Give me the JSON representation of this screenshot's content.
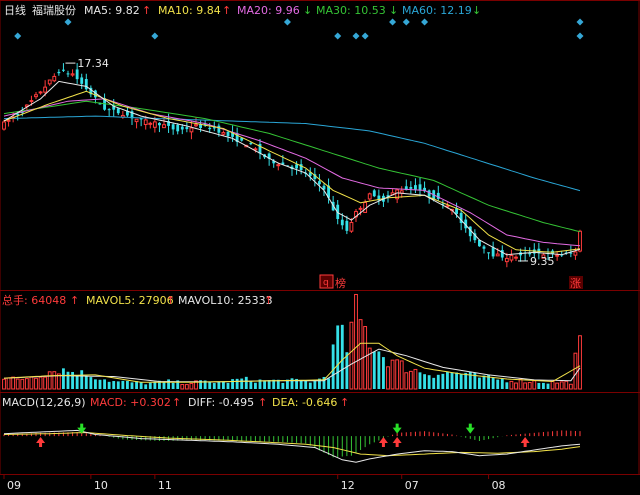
{
  "colors": {
    "up": "#ff3b3b",
    "down": "#35e0e8",
    "grid": "#7a0000",
    "ma5": "#e8e8e8",
    "ma10": "#f2e24a",
    "ma20": "#e36be3",
    "ma30": "#35c435",
    "ma60": "#2aa6d6",
    "diff": "#e8e8e8",
    "dea": "#f2e24a",
    "macd_pos": "#ff3b3b",
    "macd_neg": "#35c435",
    "marker": "#35a7d6"
  },
  "header": {
    "period": "日线",
    "stock_name": "福瑞股份",
    "ma5": {
      "label": "MA5: 9.82",
      "dir": "up"
    },
    "ma10": {
      "label": "MA10: 9.84",
      "dir": "up"
    },
    "ma20": {
      "label": "MA20: 9.96",
      "dir": "down"
    },
    "ma30": {
      "label": "MA30: 10.53",
      "dir": "down"
    },
    "ma60": {
      "label": "MA60: 12.19",
      "dir": "down"
    }
  },
  "volume_header": {
    "total": {
      "label": "总手: 64048",
      "dir": "up"
    },
    "mavol5": {
      "label": "MAVOL5: 27906",
      "dir": "up"
    },
    "mavol10": {
      "label": "MAVOL10: 25333",
      "dir": "up"
    }
  },
  "macd_header": {
    "name": "MACD(12,26,9)",
    "macd": {
      "label": "MACD: +0.302",
      "dir": "up"
    },
    "diff": {
      "label": "DIFF: -0.495",
      "dir": "up"
    },
    "dea": {
      "label": "DEA: -0.646",
      "dir": "up"
    }
  },
  "annotations": {
    "high_label": "17.34",
    "low_label": "9.35",
    "badge_bang": "榜",
    "badge_zhang": "涨"
  },
  "x_axis": {
    "labels": [
      {
        "text": "09",
        "index": 0
      },
      {
        "text": "10",
        "index": 19
      },
      {
        "text": "11",
        "index": 33
      },
      {
        "text": "12",
        "index": 73
      },
      {
        "text": "07",
        "index": 87
      },
      {
        "text": "08",
        "index": 106
      }
    ]
  },
  "chart_data": {
    "type": "candlestick",
    "n_bars": 127,
    "price_range": [
      8.5,
      19.0
    ],
    "volume_range": [
      0,
      95000
    ],
    "macd_range": [
      -2.2,
      1.6
    ],
    "anchors": {
      "close": [
        [
          0,
          14.9
        ],
        [
          4,
          15.4
        ],
        [
          8,
          16.2
        ],
        [
          12,
          17.0
        ],
        [
          15,
          16.9
        ],
        [
          18,
          16.3
        ],
        [
          22,
          15.5
        ],
        [
          26,
          15.3
        ],
        [
          30,
          15.0
        ],
        [
          34,
          14.9
        ],
        [
          38,
          14.6
        ],
        [
          42,
          14.8
        ],
        [
          46,
          14.7
        ],
        [
          50,
          14.3
        ],
        [
          54,
          14.0
        ],
        [
          58,
          13.4
        ],
        [
          62,
          13.2
        ],
        [
          66,
          12.9
        ],
        [
          70,
          12.3
        ],
        [
          73,
          11.0
        ],
        [
          75,
          10.6
        ],
        [
          77,
          11.3
        ],
        [
          80,
          12.0
        ],
        [
          83,
          11.8
        ],
        [
          86,
          12.2
        ],
        [
          90,
          12.3
        ],
        [
          94,
          11.9
        ],
        [
          98,
          11.5
        ],
        [
          101,
          10.6
        ],
        [
          104,
          10.0
        ],
        [
          107,
          9.6
        ],
        [
          110,
          9.5
        ],
        [
          113,
          9.55
        ],
        [
          116,
          9.7
        ],
        [
          119,
          9.6
        ],
        [
          122,
          9.6
        ],
        [
          125,
          9.7
        ],
        [
          126,
          10.6
        ]
      ],
      "volume": [
        [
          0,
          13000
        ],
        [
          3,
          11000
        ],
        [
          8,
          18000
        ],
        [
          12,
          24000
        ],
        [
          16,
          20000
        ],
        [
          20,
          15000
        ],
        [
          24,
          9000
        ],
        [
          28,
          8000
        ],
        [
          32,
          7000
        ],
        [
          36,
          9000
        ],
        [
          40,
          7000
        ],
        [
          44,
          9000
        ],
        [
          48,
          8000
        ],
        [
          52,
          12000
        ],
        [
          56,
          10000
        ],
        [
          60,
          10000
        ],
        [
          64,
          10000
        ],
        [
          68,
          9000
        ],
        [
          71,
          18000
        ],
        [
          73,
          70000
        ],
        [
          75,
          50000
        ],
        [
          77,
          90000
        ],
        [
          80,
          60000
        ],
        [
          83,
          40000
        ],
        [
          86,
          30000
        ],
        [
          90,
          22000
        ],
        [
          94,
          18000
        ],
        [
          98,
          20000
        ],
        [
          101,
          18000
        ],
        [
          104,
          14000
        ],
        [
          108,
          12000
        ],
        [
          112,
          10000
        ],
        [
          116,
          9000
        ],
        [
          120,
          8000
        ],
        [
          124,
          8000
        ],
        [
          126,
          64048
        ]
      ],
      "ma5": [
        [
          0,
          15.0
        ],
        [
          8,
          15.9
        ],
        [
          12,
          16.6
        ],
        [
          18,
          16.4
        ],
        [
          24,
          15.6
        ],
        [
          30,
          15.2
        ],
        [
          40,
          14.8
        ],
        [
          50,
          14.3
        ],
        [
          60,
          13.3
        ],
        [
          66,
          12.9
        ],
        [
          70,
          12.2
        ],
        [
          73,
          11.3
        ],
        [
          76,
          11.0
        ],
        [
          80,
          11.6
        ],
        [
          86,
          12.1
        ],
        [
          92,
          12.0
        ],
        [
          98,
          11.4
        ],
        [
          104,
          10.2
        ],
        [
          110,
          9.6
        ],
        [
          116,
          9.7
        ],
        [
          122,
          9.6
        ],
        [
          126,
          9.82
        ]
      ],
      "ma10": [
        [
          0,
          15.0
        ],
        [
          10,
          15.7
        ],
        [
          18,
          16.2
        ],
        [
          26,
          15.6
        ],
        [
          36,
          15.1
        ],
        [
          48,
          14.7
        ],
        [
          58,
          13.8
        ],
        [
          66,
          13.1
        ],
        [
          72,
          12.2
        ],
        [
          78,
          11.7
        ],
        [
          84,
          11.9
        ],
        [
          92,
          12.0
        ],
        [
          100,
          11.4
        ],
        [
          106,
          10.4
        ],
        [
          112,
          9.8
        ],
        [
          120,
          9.7
        ],
        [
          126,
          9.84
        ]
      ],
      "ma20": [
        [
          0,
          15.2
        ],
        [
          14,
          15.8
        ],
        [
          22,
          15.9
        ],
        [
          32,
          15.3
        ],
        [
          44,
          14.9
        ],
        [
          56,
          14.2
        ],
        [
          66,
          13.5
        ],
        [
          74,
          12.7
        ],
        [
          82,
          12.3
        ],
        [
          92,
          12.2
        ],
        [
          102,
          11.3
        ],
        [
          110,
          10.4
        ],
        [
          118,
          10.1
        ],
        [
          126,
          9.96
        ]
      ],
      "ma30": [
        [
          0,
          15.3
        ],
        [
          18,
          15.8
        ],
        [
          30,
          15.5
        ],
        [
          44,
          15.1
        ],
        [
          58,
          14.5
        ],
        [
          70,
          13.8
        ],
        [
          82,
          13.1
        ],
        [
          94,
          12.6
        ],
        [
          106,
          11.6
        ],
        [
          118,
          10.9
        ],
        [
          126,
          10.53
        ]
      ],
      "ma60": [
        [
          0,
          15.1
        ],
        [
          20,
          15.2
        ],
        [
          34,
          15.1
        ],
        [
          50,
          15.0
        ],
        [
          66,
          14.9
        ],
        [
          80,
          14.6
        ],
        [
          92,
          14.1
        ],
        [
          104,
          13.4
        ],
        [
          116,
          12.7
        ],
        [
          126,
          12.19
        ]
      ],
      "mavol5": [
        [
          0,
          13000
        ],
        [
          10,
          16000
        ],
        [
          20,
          17000
        ],
        [
          30,
          8000
        ],
        [
          40,
          8000
        ],
        [
          50,
          9000
        ],
        [
          60,
          10000
        ],
        [
          70,
          11000
        ],
        [
          74,
          35000
        ],
        [
          78,
          55000
        ],
        [
          82,
          55000
        ],
        [
          86,
          40000
        ],
        [
          92,
          25000
        ],
        [
          100,
          18000
        ],
        [
          110,
          12000
        ],
        [
          120,
          9000
        ],
        [
          126,
          27906
        ]
      ],
      "mavol10": [
        [
          0,
          13000
        ],
        [
          12,
          16000
        ],
        [
          24,
          15000
        ],
        [
          34,
          9000
        ],
        [
          46,
          8500
        ],
        [
          58,
          10000
        ],
        [
          70,
          10000
        ],
        [
          76,
          30000
        ],
        [
          82,
          48000
        ],
        [
          88,
          40000
        ],
        [
          96,
          26000
        ],
        [
          106,
          17000
        ],
        [
          116,
          11000
        ],
        [
          124,
          10000
        ],
        [
          126,
          25333
        ]
      ],
      "diff": [
        [
          0,
          0.15
        ],
        [
          8,
          0.25
        ],
        [
          16,
          0.35
        ],
        [
          20,
          0.1
        ],
        [
          30,
          -0.15
        ],
        [
          40,
          -0.25
        ],
        [
          50,
          -0.35
        ],
        [
          60,
          -0.5
        ],
        [
          68,
          -0.7
        ],
        [
          74,
          -1.45
        ],
        [
          77,
          -1.6
        ],
        [
          80,
          -1.4
        ],
        [
          86,
          -1.1
        ],
        [
          92,
          -0.9
        ],
        [
          98,
          -0.95
        ],
        [
          104,
          -1.2
        ],
        [
          110,
          -1.1
        ],
        [
          116,
          -0.85
        ],
        [
          122,
          -0.6
        ],
        [
          126,
          -0.495
        ]
      ],
      "dea": [
        [
          0,
          0.1
        ],
        [
          10,
          0.15
        ],
        [
          18,
          0.22
        ],
        [
          26,
          0.05
        ],
        [
          36,
          -0.12
        ],
        [
          46,
          -0.22
        ],
        [
          56,
          -0.35
        ],
        [
          66,
          -0.5
        ],
        [
          72,
          -0.7
        ],
        [
          78,
          -1.1
        ],
        [
          84,
          -1.2
        ],
        [
          92,
          -1.1
        ],
        [
          100,
          -1.0
        ],
        [
          108,
          -1.05
        ],
        [
          116,
          -0.95
        ],
        [
          122,
          -0.8
        ],
        [
          126,
          -0.646
        ]
      ],
      "macd": [
        [
          0,
          0.1
        ],
        [
          8,
          0.2
        ],
        [
          16,
          0.25
        ],
        [
          20,
          0.1
        ],
        [
          26,
          -0.2
        ],
        [
          34,
          -0.3
        ],
        [
          44,
          -0.25
        ],
        [
          52,
          -0.3
        ],
        [
          60,
          -0.35
        ],
        [
          66,
          -0.45
        ],
        [
          72,
          -1.3
        ],
        [
          76,
          -1.2
        ],
        [
          80,
          -0.5
        ],
        [
          86,
          0.2
        ],
        [
          92,
          0.3
        ],
        [
          98,
          0.1
        ],
        [
          104,
          -0.3
        ],
        [
          110,
          0.05
        ],
        [
          116,
          0.2
        ],
        [
          122,
          0.35
        ],
        [
          126,
          0.302
        ]
      ]
    },
    "high_point": {
      "index": 13,
      "value": 17.34
    },
    "low_point": {
      "index": 112,
      "value": 9.35
    },
    "ma_markers": [
      {
        "index": 14,
        "row": "top"
      },
      {
        "index": 62,
        "row": "top"
      },
      {
        "index": 85,
        "row": "top"
      },
      {
        "index": 88,
        "row": "top"
      },
      {
        "index": 92,
        "row": "top"
      },
      {
        "index": 126,
        "row": "top"
      },
      {
        "index": 3,
        "row": "bottom"
      },
      {
        "index": 33,
        "row": "bottom"
      },
      {
        "index": 73,
        "row": "bottom"
      },
      {
        "index": 77,
        "row": "bottom"
      },
      {
        "index": 79,
        "row": "bottom"
      },
      {
        "index": 126,
        "row": "bottom"
      }
    ],
    "macd_signals": [
      {
        "index": 8,
        "dir": "up"
      },
      {
        "index": 17,
        "dir": "down"
      },
      {
        "index": 83,
        "dir": "up"
      },
      {
        "index": 86,
        "dir": "down"
      },
      {
        "index": 86,
        "dir": "up"
      },
      {
        "index": 102,
        "dir": "down"
      },
      {
        "index": 114,
        "dir": "up"
      }
    ]
  }
}
